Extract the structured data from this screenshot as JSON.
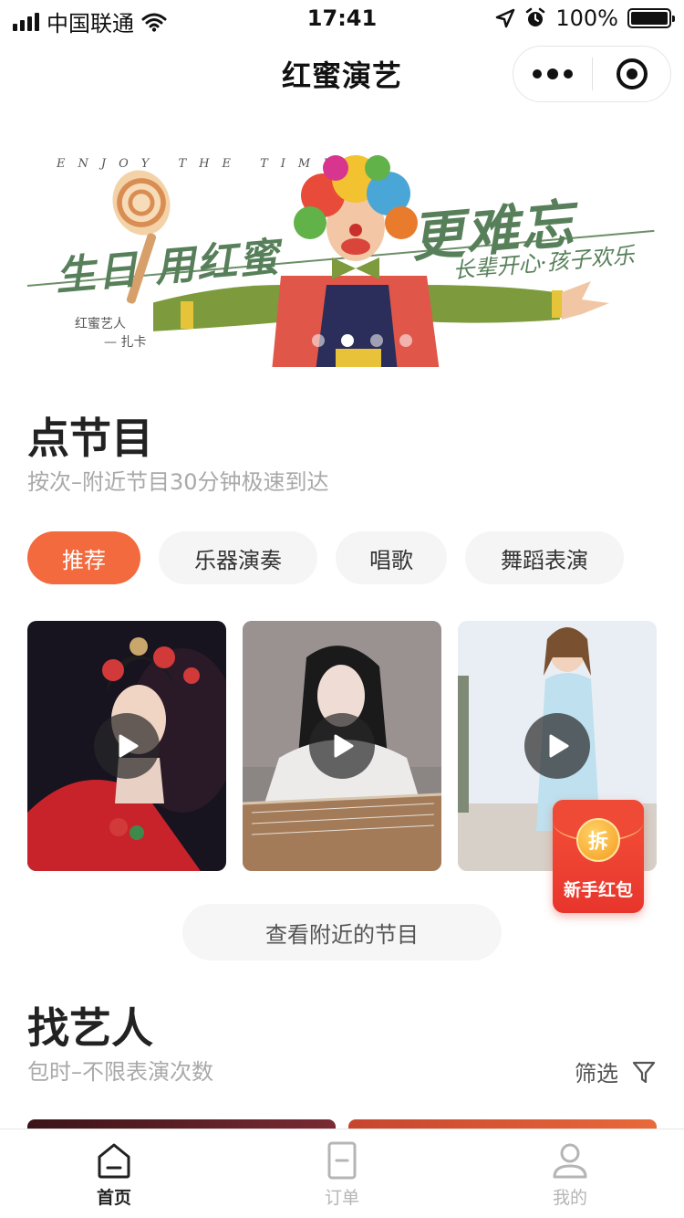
{
  "status_bar": {
    "carrier": "中国联通",
    "time": "17:41",
    "battery": "100%"
  },
  "nav": {
    "title": "红蜜演艺"
  },
  "banner": {
    "tagline": "ENJOY THE TIME",
    "headline_left": "生日 用红蜜",
    "headline_right": "更难忘",
    "subline": "长辈开心·孩子欢乐",
    "credit_name": "红蜜艺人",
    "credit_artist": "— 扎卡",
    "slide_count": 4,
    "active_slide": 2
  },
  "programs": {
    "title": "点节目",
    "subtitle": "按次–附近节目30分钟极速到达",
    "categories": [
      {
        "label": "推荐",
        "active": true
      },
      {
        "label": "乐器演奏",
        "active": false
      },
      {
        "label": "唱歌",
        "active": false
      },
      {
        "label": "舞蹈表演",
        "active": false
      }
    ],
    "more_button": "查看附近的节目"
  },
  "red_packet": {
    "coin": "拆",
    "label": "新手红包"
  },
  "artists": {
    "title": "找艺人",
    "subtitle": "包时–不限表演次数",
    "filter_label": "筛选"
  },
  "tab_bar": [
    {
      "label": "首页",
      "active": true
    },
    {
      "label": "订单",
      "active": false
    },
    {
      "label": "我的",
      "active": false
    }
  ],
  "colors": {
    "accent": "#f26a3d",
    "banner_green": "#57805a",
    "red_packet": "#e8352c"
  }
}
